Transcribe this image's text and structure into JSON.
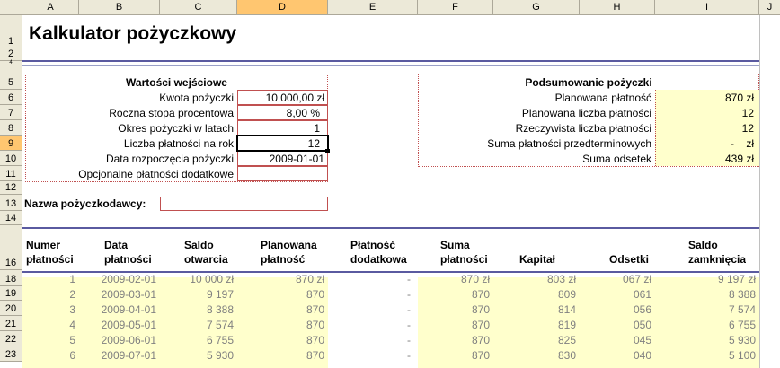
{
  "columns": [
    "A",
    "B",
    "C",
    "D",
    "E",
    "F",
    "G",
    "H",
    "I",
    "J"
  ],
  "rows": [
    "1",
    "2",
    "4",
    "5",
    "6",
    "7",
    "8",
    "9",
    "10",
    "11",
    "12",
    "13",
    "14",
    "16",
    "18",
    "19",
    "20",
    "21",
    "22",
    "23"
  ],
  "title": "Kalkulator pożyczkowy",
  "inputs": {
    "header": "Wartości wejściowe",
    "items": [
      {
        "label": "Kwota pożyczki",
        "value": "10 000,00 zł"
      },
      {
        "label": "Roczna stopa procentowa",
        "value": "8,00  %"
      },
      {
        "label": "Okres pożyczki w latach",
        "value": "1"
      },
      {
        "label": "Liczba płatności na rok",
        "value": "12"
      },
      {
        "label": "Data rozpoczęcia pożyczki",
        "value": "2009-01-01"
      },
      {
        "label": "Opcjonalne płatności dodatkowe",
        "value": ""
      }
    ]
  },
  "summary": {
    "header": "Podsumowanie pożyczki",
    "items": [
      {
        "label": "Planowana płatność",
        "value": "870 zł"
      },
      {
        "label": "Planowana liczba płatności",
        "value": "12"
      },
      {
        "label": "Rzeczywista liczba płatności",
        "value": "12"
      },
      {
        "label": "Suma płatności przedterminowych",
        "value": "-    zł"
      },
      {
        "label": "Suma odsetek",
        "value": "439 zł"
      }
    ]
  },
  "lender": {
    "label": "Nazwa pożyczkodawcy:",
    "value": ""
  },
  "table": {
    "headers": [
      [
        "Numer",
        "płatności"
      ],
      [
        "Data",
        "płatności"
      ],
      [
        "Saldo",
        "otwarcia"
      ],
      [
        "Planowana",
        "płatność"
      ],
      [
        "Płatność",
        "dodatkowa"
      ],
      [
        "Suma",
        "płatności"
      ],
      [
        "",
        "Kapitał"
      ],
      [
        "",
        "Odsetki"
      ],
      [
        "Saldo",
        "zamknięcia"
      ]
    ],
    "rows": [
      [
        "1",
        "2009-02-01",
        "10 000 zł",
        "870 zł",
        "-",
        "870 zł",
        "803 zł",
        "067 zł",
        "9 197 zł"
      ],
      [
        "2",
        "2009-03-01",
        "9 197",
        "870",
        "-",
        "870",
        "809",
        "061",
        "8 388"
      ],
      [
        "3",
        "2009-04-01",
        "8 388",
        "870",
        "-",
        "870",
        "814",
        "056",
        "7 574"
      ],
      [
        "4",
        "2009-05-01",
        "7 574",
        "870",
        "-",
        "870",
        "819",
        "050",
        "6 755"
      ],
      [
        "5",
        "2009-06-01",
        "6 755",
        "870",
        "-",
        "870",
        "825",
        "045",
        "5 930"
      ],
      [
        "6",
        "2009-07-01",
        "5 930",
        "870",
        "-",
        "870",
        "830",
        "040",
        "5 100"
      ]
    ]
  },
  "colors": {
    "header_bg": "#ece9d8",
    "selected_header": "#ffc670",
    "yellow_fill": "#ffffcc",
    "rule": "#5a5aa0",
    "dotted_border": "#c05050"
  }
}
